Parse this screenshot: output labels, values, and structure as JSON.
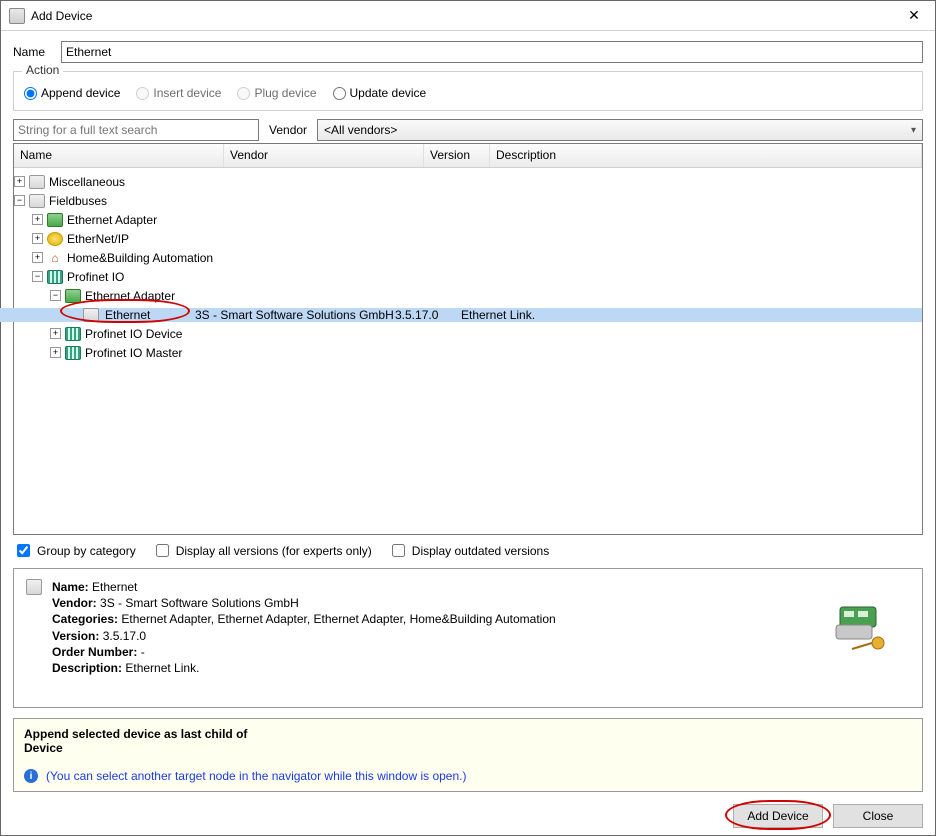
{
  "window": {
    "title": "Add Device"
  },
  "name": {
    "label": "Name",
    "value": "Ethernet"
  },
  "action": {
    "legend": "Action",
    "options": {
      "append": "Append device",
      "insert": "Insert device",
      "plug": "Plug device",
      "update": "Update device"
    },
    "selected": "append",
    "disabled": [
      "insert",
      "plug"
    ]
  },
  "filter": {
    "search_placeholder": "String for a full text search",
    "vendor_label": "Vendor",
    "vendor_value": "<All vendors>"
  },
  "columns": {
    "name": "Name",
    "vendor": "Vendor",
    "version": "Version",
    "description": "Description"
  },
  "tree": {
    "miscellaneous": "Miscellaneous",
    "fieldbuses": "Fieldbuses",
    "eth_adapter": "Ethernet Adapter",
    "ethernet_ip": "EtherNet/IP",
    "home_building": "Home&Building Automation",
    "profinet_io": "Profinet IO",
    "eth_adapter2": "Ethernet Adapter",
    "ethernet": {
      "name": "Ethernet",
      "vendor": "3S - Smart Software Solutions GmbH",
      "version": "3.5.17.0",
      "description": "Ethernet Link."
    },
    "pn_device": "Profinet IO Device",
    "pn_master": "Profinet IO Master"
  },
  "options": {
    "group_by_category": "Group by category",
    "display_all": "Display all versions (for experts only)",
    "display_outdated": "Display outdated versions"
  },
  "options_state": {
    "group_by_category": true,
    "display_all": false,
    "display_outdated": false
  },
  "detail": {
    "name_label": "Name:",
    "name": "Ethernet",
    "vendor_label": "Vendor:",
    "vendor": "3S - Smart Software Solutions GmbH",
    "categories_label": "Categories:",
    "categories": "Ethernet Adapter, Ethernet Adapter, Ethernet Adapter, Home&Building Automation",
    "version_label": "Version:",
    "version": "3.5.17.0",
    "order_label": "Order Number:",
    "order": "-",
    "description_label": "Description:",
    "description": "Ethernet Link."
  },
  "msg": {
    "headline": "Append selected device as last child of",
    "target": "Device",
    "info": "(You can select another target node in the navigator while this window is open.)"
  },
  "buttons": {
    "add": "Add Device",
    "close": "Close"
  }
}
